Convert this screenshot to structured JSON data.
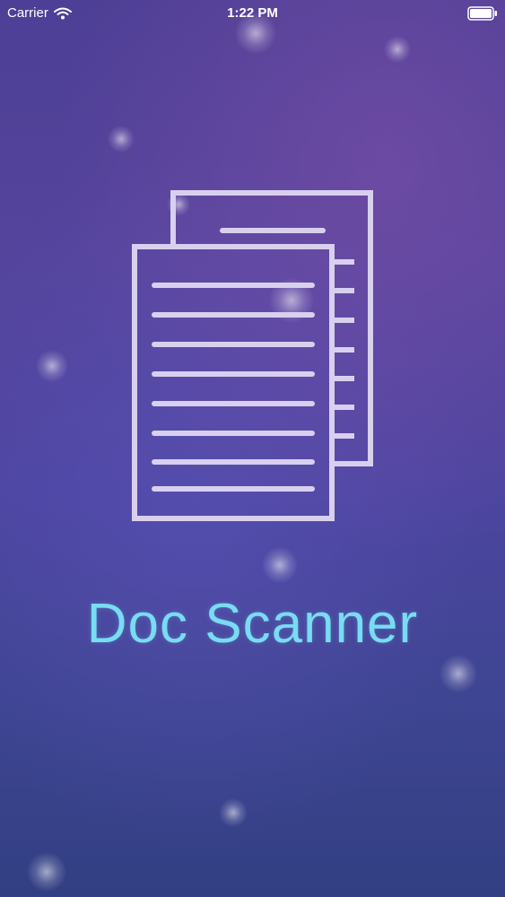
{
  "status_bar": {
    "carrier": "Carrier",
    "time": "1:22 PM",
    "wifi_icon": "wifi-icon",
    "battery_icon": "battery-icon"
  },
  "splash": {
    "illustration_icon": "documents-icon",
    "title": "Doc Scanner"
  },
  "colors": {
    "title": "#78dcf2",
    "illustration_stroke": "#d8d0ee",
    "background_top": "#4d3f95",
    "background_bottom": "#323f82"
  }
}
